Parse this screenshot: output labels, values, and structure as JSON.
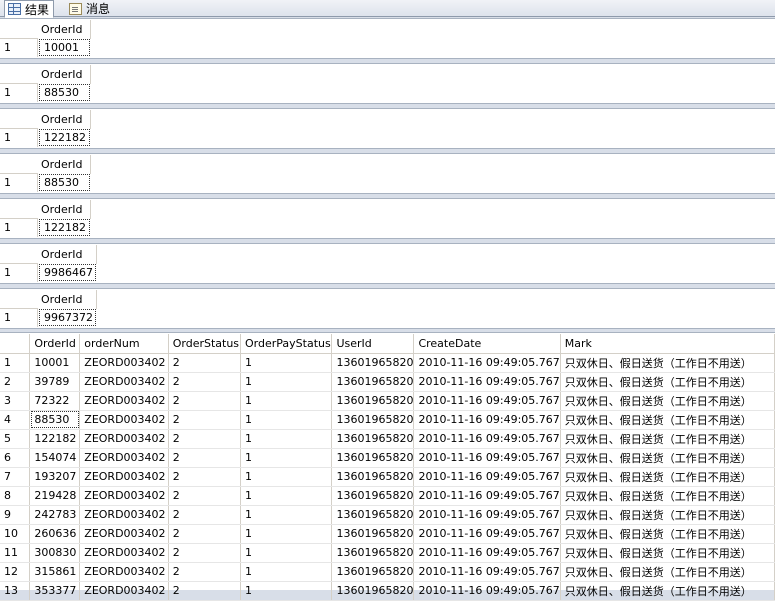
{
  "tabs": [
    {
      "label": "结果",
      "icon": "grid-icon"
    },
    {
      "label": "消息",
      "icon": "message-icon"
    }
  ],
  "single_results": [
    {
      "header": "OrderId",
      "row": "1",
      "value": "10001"
    },
    {
      "header": "OrderId",
      "row": "1",
      "value": "88530"
    },
    {
      "header": "OrderId",
      "row": "1",
      "value": "122182"
    },
    {
      "header": "OrderId",
      "row": "1",
      "value": "88530"
    },
    {
      "header": "OrderId",
      "row": "1",
      "value": "122182"
    },
    {
      "header": "OrderId",
      "row": "1",
      "value": "9986467"
    },
    {
      "header": "OrderId",
      "row": "1",
      "value": "9967372"
    }
  ],
  "main_grid": {
    "columns": [
      "OrderId",
      "orderNum",
      "OrderStatus",
      "OrderPayStatus",
      "UserId",
      "CreateDate",
      "Mark"
    ],
    "rows": [
      [
        "1",
        "10001",
        "ZEORD003402",
        "2",
        "1",
        "13601965820",
        "2010-11-16 09:49:05.767",
        "只双休日、假日送货（工作日不用送）"
      ],
      [
        "2",
        "39789",
        "ZEORD003402",
        "2",
        "1",
        "13601965820",
        "2010-11-16 09:49:05.767",
        "只双休日、假日送货（工作日不用送）"
      ],
      [
        "3",
        "72322",
        "ZEORD003402",
        "2",
        "1",
        "13601965820",
        "2010-11-16 09:49:05.767",
        "只双休日、假日送货（工作日不用送）"
      ],
      [
        "4",
        "88530",
        "ZEORD003402",
        "2",
        "1",
        "13601965820",
        "2010-11-16 09:49:05.767",
        "只双休日、假日送货（工作日不用送）"
      ],
      [
        "5",
        "122182",
        "ZEORD003402",
        "2",
        "1",
        "13601965820",
        "2010-11-16 09:49:05.767",
        "只双休日、假日送货（工作日不用送）"
      ],
      [
        "6",
        "154074",
        "ZEORD003402",
        "2",
        "1",
        "13601965820",
        "2010-11-16 09:49:05.767",
        "只双休日、假日送货（工作日不用送）"
      ],
      [
        "7",
        "193207",
        "ZEORD003402",
        "2",
        "1",
        "13601965820",
        "2010-11-16 09:49:05.767",
        "只双休日、假日送货（工作日不用送）"
      ],
      [
        "8",
        "219428",
        "ZEORD003402",
        "2",
        "1",
        "13601965820",
        "2010-11-16 09:49:05.767",
        "只双休日、假日送货（工作日不用送）"
      ],
      [
        "9",
        "242783",
        "ZEORD003402",
        "2",
        "1",
        "13601965820",
        "2010-11-16 09:49:05.767",
        "只双休日、假日送货（工作日不用送）"
      ],
      [
        "10",
        "260636",
        "ZEORD003402",
        "2",
        "1",
        "13601965820",
        "2010-11-16 09:49:05.767",
        "只双休日、假日送货（工作日不用送）"
      ],
      [
        "11",
        "300830",
        "ZEORD003402",
        "2",
        "1",
        "13601965820",
        "2010-11-16 09:49:05.767",
        "只双休日、假日送货（工作日不用送）"
      ],
      [
        "12",
        "315861",
        "ZEORD003402",
        "2",
        "1",
        "13601965820",
        "2010-11-16 09:49:05.767",
        "只双休日、假日送货（工作日不用送）"
      ],
      [
        "13",
        "353377",
        "ZEORD003402",
        "2",
        "1",
        "13601965820",
        "2010-11-16 09:49:05.767",
        "只双休日、假日送货（工作日不用送）"
      ]
    ]
  }
}
